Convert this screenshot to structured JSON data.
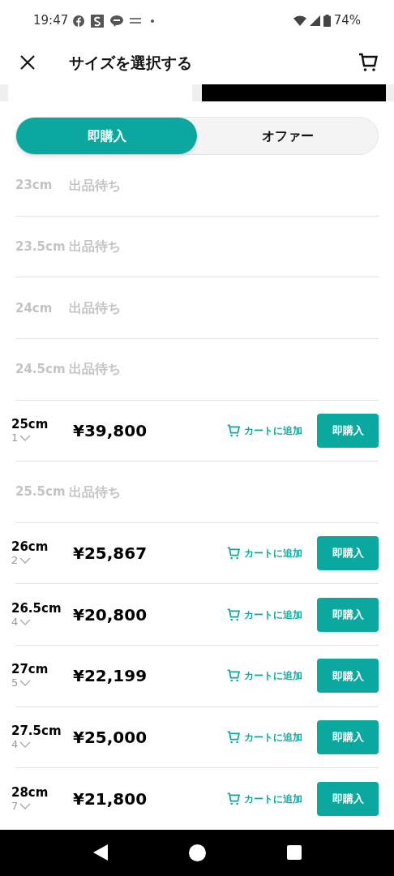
{
  "status_bar": {
    "time": "19:47",
    "battery": "74%"
  },
  "header": {
    "title": "サイズを選択する"
  },
  "condition_tabs": [
    {
      "selected": false
    },
    {
      "selected": true
    }
  ],
  "mode_toggle": [
    {
      "label": "即購入",
      "selected": true
    },
    {
      "label": "オファー",
      "selected": false
    }
  ],
  "sizes": [
    {
      "kind": "waiting",
      "size": "23cm",
      "status": "出品待ち"
    },
    {
      "kind": "waiting",
      "size": "23.5cm",
      "status": "出品待ち"
    },
    {
      "kind": "waiting",
      "size": "24cm",
      "status": "出品待ち"
    },
    {
      "kind": "waiting",
      "size": "24.5cm",
      "status": "出品待ち"
    },
    {
      "kind": "available",
      "size": "25cm",
      "quantity": "1",
      "price": "¥39,800",
      "cart": "カートに追加",
      "buy": "即購入"
    },
    {
      "kind": "waiting",
      "size": "25.5cm",
      "status": "出品待ち"
    },
    {
      "kind": "available",
      "size": "26cm",
      "quantity": "2",
      "price": "¥25,867",
      "cart": "カートに追加",
      "buy": "即購入"
    },
    {
      "kind": "available",
      "size": "26.5cm",
      "quantity": "4",
      "price": "¥20,800",
      "cart": "カートに追加",
      "buy": "即購入"
    },
    {
      "kind": "available",
      "size": "27cm",
      "quantity": "5",
      "price": "¥22,199",
      "cart": "カートに追加",
      "buy": "即購入"
    },
    {
      "kind": "available",
      "size": "27.5cm",
      "quantity": "4",
      "price": "¥25,000",
      "cart": "カートに追加",
      "buy": "即購入"
    },
    {
      "kind": "available",
      "size": "28cm",
      "quantity": "7",
      "price": "¥21,800",
      "cart": "カートに追加",
      "buy": "即購入"
    }
  ]
}
